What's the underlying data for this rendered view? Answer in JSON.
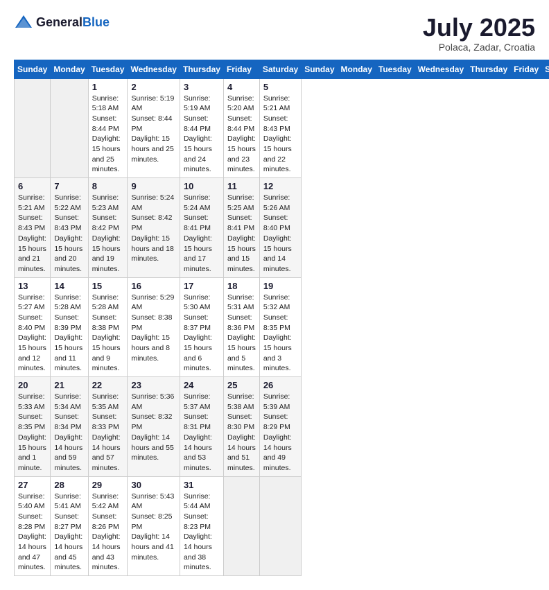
{
  "header": {
    "logo_general": "General",
    "logo_blue": "Blue",
    "month_title": "July 2025",
    "subtitle": "Polaca, Zadar, Croatia"
  },
  "days_of_week": [
    "Sunday",
    "Monday",
    "Tuesday",
    "Wednesday",
    "Thursday",
    "Friday",
    "Saturday"
  ],
  "weeks": [
    [
      {
        "day": "",
        "sunrise": "",
        "sunset": "",
        "daylight": ""
      },
      {
        "day": "",
        "sunrise": "",
        "sunset": "",
        "daylight": ""
      },
      {
        "day": "1",
        "sunrise": "Sunrise: 5:18 AM",
        "sunset": "Sunset: 8:44 PM",
        "daylight": "Daylight: 15 hours and 25 minutes."
      },
      {
        "day": "2",
        "sunrise": "Sunrise: 5:19 AM",
        "sunset": "Sunset: 8:44 PM",
        "daylight": "Daylight: 15 hours and 25 minutes."
      },
      {
        "day": "3",
        "sunrise": "Sunrise: 5:19 AM",
        "sunset": "Sunset: 8:44 PM",
        "daylight": "Daylight: 15 hours and 24 minutes."
      },
      {
        "day": "4",
        "sunrise": "Sunrise: 5:20 AM",
        "sunset": "Sunset: 8:44 PM",
        "daylight": "Daylight: 15 hours and 23 minutes."
      },
      {
        "day": "5",
        "sunrise": "Sunrise: 5:21 AM",
        "sunset": "Sunset: 8:43 PM",
        "daylight": "Daylight: 15 hours and 22 minutes."
      }
    ],
    [
      {
        "day": "6",
        "sunrise": "Sunrise: 5:21 AM",
        "sunset": "Sunset: 8:43 PM",
        "daylight": "Daylight: 15 hours and 21 minutes."
      },
      {
        "day": "7",
        "sunrise": "Sunrise: 5:22 AM",
        "sunset": "Sunset: 8:43 PM",
        "daylight": "Daylight: 15 hours and 20 minutes."
      },
      {
        "day": "8",
        "sunrise": "Sunrise: 5:23 AM",
        "sunset": "Sunset: 8:42 PM",
        "daylight": "Daylight: 15 hours and 19 minutes."
      },
      {
        "day": "9",
        "sunrise": "Sunrise: 5:24 AM",
        "sunset": "Sunset: 8:42 PM",
        "daylight": "Daylight: 15 hours and 18 minutes."
      },
      {
        "day": "10",
        "sunrise": "Sunrise: 5:24 AM",
        "sunset": "Sunset: 8:41 PM",
        "daylight": "Daylight: 15 hours and 17 minutes."
      },
      {
        "day": "11",
        "sunrise": "Sunrise: 5:25 AM",
        "sunset": "Sunset: 8:41 PM",
        "daylight": "Daylight: 15 hours and 15 minutes."
      },
      {
        "day": "12",
        "sunrise": "Sunrise: 5:26 AM",
        "sunset": "Sunset: 8:40 PM",
        "daylight": "Daylight: 15 hours and 14 minutes."
      }
    ],
    [
      {
        "day": "13",
        "sunrise": "Sunrise: 5:27 AM",
        "sunset": "Sunset: 8:40 PM",
        "daylight": "Daylight: 15 hours and 12 minutes."
      },
      {
        "day": "14",
        "sunrise": "Sunrise: 5:28 AM",
        "sunset": "Sunset: 8:39 PM",
        "daylight": "Daylight: 15 hours and 11 minutes."
      },
      {
        "day": "15",
        "sunrise": "Sunrise: 5:28 AM",
        "sunset": "Sunset: 8:38 PM",
        "daylight": "Daylight: 15 hours and 9 minutes."
      },
      {
        "day": "16",
        "sunrise": "Sunrise: 5:29 AM",
        "sunset": "Sunset: 8:38 PM",
        "daylight": "Daylight: 15 hours and 8 minutes."
      },
      {
        "day": "17",
        "sunrise": "Sunrise: 5:30 AM",
        "sunset": "Sunset: 8:37 PM",
        "daylight": "Daylight: 15 hours and 6 minutes."
      },
      {
        "day": "18",
        "sunrise": "Sunrise: 5:31 AM",
        "sunset": "Sunset: 8:36 PM",
        "daylight": "Daylight: 15 hours and 5 minutes."
      },
      {
        "day": "19",
        "sunrise": "Sunrise: 5:32 AM",
        "sunset": "Sunset: 8:35 PM",
        "daylight": "Daylight: 15 hours and 3 minutes."
      }
    ],
    [
      {
        "day": "20",
        "sunrise": "Sunrise: 5:33 AM",
        "sunset": "Sunset: 8:35 PM",
        "daylight": "Daylight: 15 hours and 1 minute."
      },
      {
        "day": "21",
        "sunrise": "Sunrise: 5:34 AM",
        "sunset": "Sunset: 8:34 PM",
        "daylight": "Daylight: 14 hours and 59 minutes."
      },
      {
        "day": "22",
        "sunrise": "Sunrise: 5:35 AM",
        "sunset": "Sunset: 8:33 PM",
        "daylight": "Daylight: 14 hours and 57 minutes."
      },
      {
        "day": "23",
        "sunrise": "Sunrise: 5:36 AM",
        "sunset": "Sunset: 8:32 PM",
        "daylight": "Daylight: 14 hours and 55 minutes."
      },
      {
        "day": "24",
        "sunrise": "Sunrise: 5:37 AM",
        "sunset": "Sunset: 8:31 PM",
        "daylight": "Daylight: 14 hours and 53 minutes."
      },
      {
        "day": "25",
        "sunrise": "Sunrise: 5:38 AM",
        "sunset": "Sunset: 8:30 PM",
        "daylight": "Daylight: 14 hours and 51 minutes."
      },
      {
        "day": "26",
        "sunrise": "Sunrise: 5:39 AM",
        "sunset": "Sunset: 8:29 PM",
        "daylight": "Daylight: 14 hours and 49 minutes."
      }
    ],
    [
      {
        "day": "27",
        "sunrise": "Sunrise: 5:40 AM",
        "sunset": "Sunset: 8:28 PM",
        "daylight": "Daylight: 14 hours and 47 minutes."
      },
      {
        "day": "28",
        "sunrise": "Sunrise: 5:41 AM",
        "sunset": "Sunset: 8:27 PM",
        "daylight": "Daylight: 14 hours and 45 minutes."
      },
      {
        "day": "29",
        "sunrise": "Sunrise: 5:42 AM",
        "sunset": "Sunset: 8:26 PM",
        "daylight": "Daylight: 14 hours and 43 minutes."
      },
      {
        "day": "30",
        "sunrise": "Sunrise: 5:43 AM",
        "sunset": "Sunset: 8:25 PM",
        "daylight": "Daylight: 14 hours and 41 minutes."
      },
      {
        "day": "31",
        "sunrise": "Sunrise: 5:44 AM",
        "sunset": "Sunset: 8:23 PM",
        "daylight": "Daylight: 14 hours and 38 minutes."
      },
      {
        "day": "",
        "sunrise": "",
        "sunset": "",
        "daylight": ""
      },
      {
        "day": "",
        "sunrise": "",
        "sunset": "",
        "daylight": ""
      }
    ]
  ]
}
